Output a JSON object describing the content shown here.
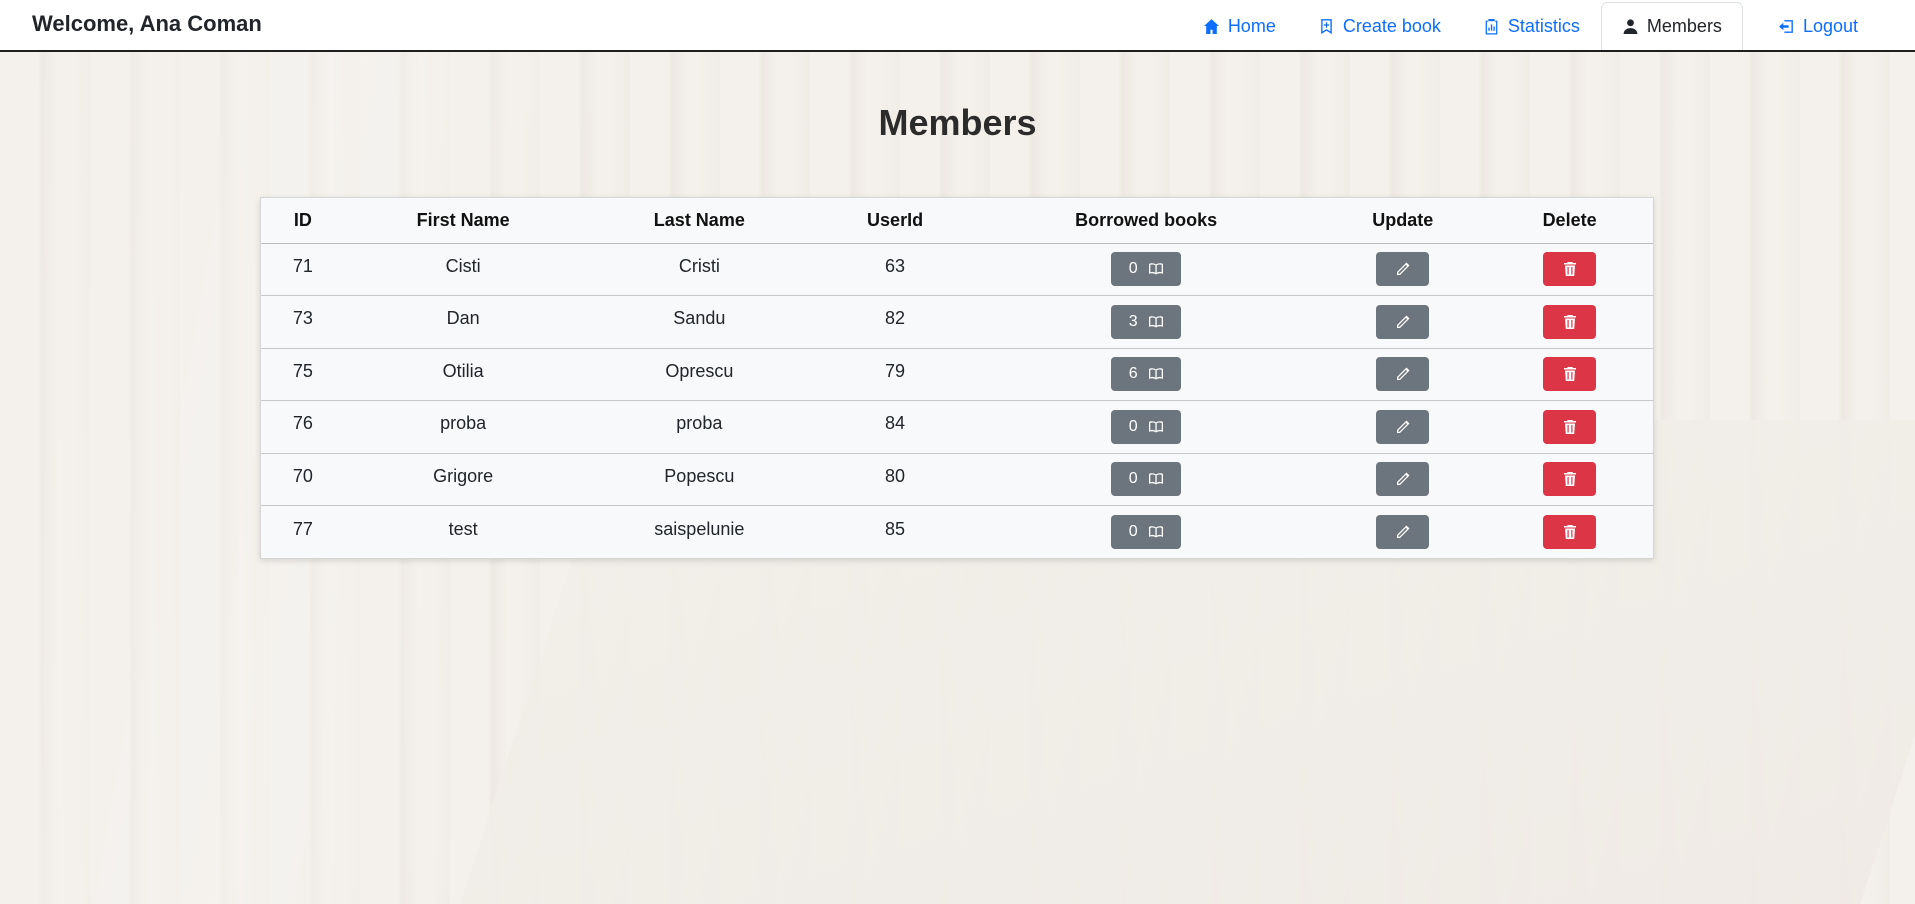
{
  "navbar": {
    "brand": "Welcome, Ana Coman",
    "items": [
      {
        "label": "Home",
        "icon": "home-icon"
      },
      {
        "label": "Create book",
        "icon": "bookmark-plus-icon"
      },
      {
        "label": "Statistics",
        "icon": "clipboard-data-icon"
      },
      {
        "label": "Members",
        "icon": "person-icon",
        "active": true
      },
      {
        "label": "Logout",
        "icon": "logout-icon"
      }
    ]
  },
  "page": {
    "title": "Members"
  },
  "table": {
    "headers": [
      "ID",
      "First Name",
      "Last Name",
      "UserId",
      "Borrowed books",
      "Update",
      "Delete"
    ],
    "rows": [
      {
        "id": "71",
        "first": "Cisti",
        "last": "Cristi",
        "userId": "63",
        "borrowed": "0"
      },
      {
        "id": "73",
        "first": "Dan",
        "last": "Sandu",
        "userId": "82",
        "borrowed": "3"
      },
      {
        "id": "75",
        "first": "Otilia",
        "last": "Oprescu",
        "userId": "79",
        "borrowed": "6"
      },
      {
        "id": "76",
        "first": "proba",
        "last": "proba",
        "userId": "84",
        "borrowed": "0"
      },
      {
        "id": "70",
        "first": "Grigore",
        "last": "Popescu",
        "userId": "80",
        "borrowed": "0"
      },
      {
        "id": "77",
        "first": "test",
        "last": "saispelunie",
        "userId": "85",
        "borrowed": "0"
      }
    ]
  },
  "colors": {
    "link": "#0d6efd",
    "secondary_button": "#6c757d",
    "danger_button": "#dc3545"
  }
}
